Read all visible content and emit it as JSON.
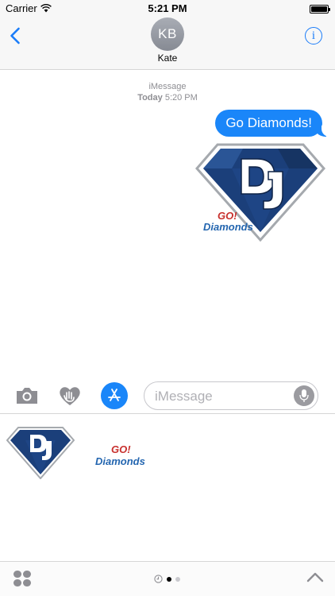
{
  "status_bar": {
    "carrier": "Carrier",
    "time": "5:21 PM"
  },
  "header": {
    "avatar_initials": "KB",
    "contact_name": "Kate",
    "back_icon": "chevron-left-icon",
    "info_icon": "info-icon"
  },
  "conversation": {
    "service": "iMessage",
    "day": "Today",
    "time": "5:20 PM",
    "messages": [
      {
        "type": "text",
        "text": "Go Diamonds!"
      },
      {
        "type": "sticker",
        "sticker": "dj-diamond-logo"
      }
    ]
  },
  "toolbar": {
    "camera_icon": "camera-icon",
    "digital_touch_icon": "heart-hand-icon",
    "appstore_icon": "app-store-icon",
    "input_placeholder": "iMessage",
    "mic_icon": "microphone-icon"
  },
  "drawer": {
    "stickers": [
      "dj-diamond-logo",
      "go-diamonds-wordmark"
    ]
  },
  "bottom_bar": {
    "grid_icon": "app-grid-icon",
    "history_icon": "clock-icon",
    "expand_icon": "chevron-up-icon",
    "active_page": 1,
    "page_count": 2
  },
  "colors": {
    "accent": "#1a86f9",
    "logo_navy": "#1b3f7a",
    "logo_red": "#c8312e",
    "logo_blue": "#2466b0"
  }
}
